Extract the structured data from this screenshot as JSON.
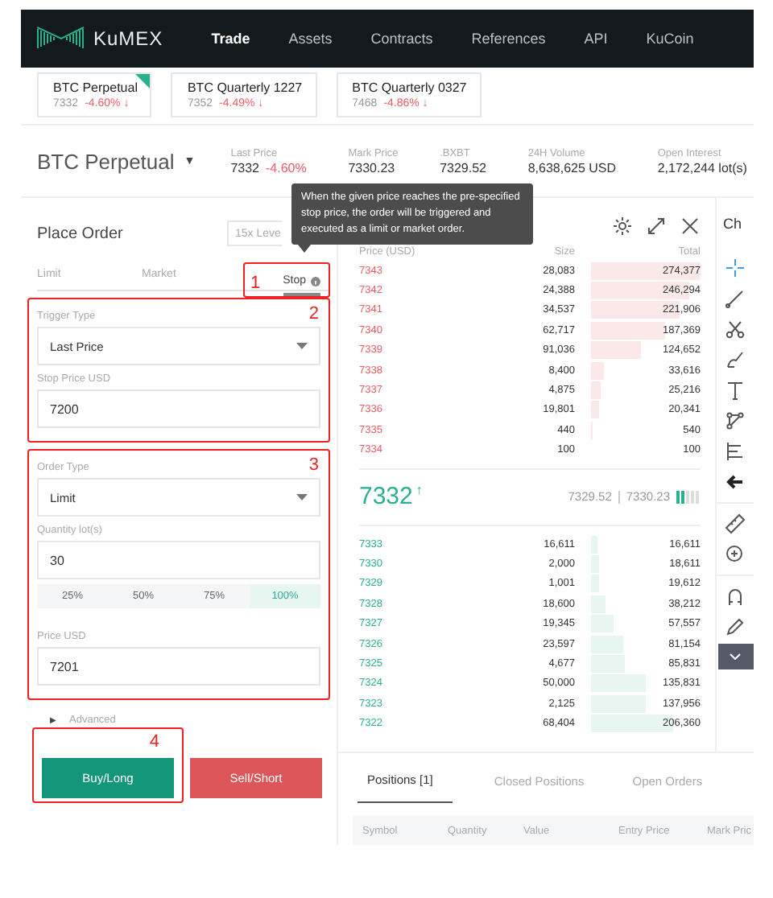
{
  "nav": {
    "logo": "KuMEX",
    "items": [
      {
        "label": "Trade",
        "selected": true
      },
      {
        "label": "Assets",
        "selected": false
      },
      {
        "label": "Contracts",
        "selected": false
      },
      {
        "label": "References",
        "selected": false
      },
      {
        "label": "API",
        "selected": false
      },
      {
        "label": "KuCoin",
        "selected": false
      }
    ]
  },
  "tickers": [
    {
      "name": "BTC Perpetual",
      "price": "7332",
      "change": "-4.60% ↓",
      "selected": true
    },
    {
      "name": "BTC Quarterly 1227",
      "price": "7352",
      "change": "-4.49% ↓",
      "selected": false
    },
    {
      "name": "BTC Quarterly 0327",
      "price": "7468",
      "change": "-4.86% ↓",
      "selected": false
    }
  ],
  "contract": {
    "name": "BTC Perpetual",
    "caret": "▼",
    "stats": [
      {
        "label": "Last Price",
        "value": "7332",
        "change": "-4.60%"
      },
      {
        "label": "Mark Price",
        "value": "7330.23"
      },
      {
        "label": ".BXBT",
        "value": "7329.52"
      },
      {
        "label": "24H Volume",
        "value": "8,638,625 USD"
      },
      {
        "label": "Open Interest",
        "value": "2,172,244 lot(s)"
      }
    ]
  },
  "tooltip": "When the given price reaches the pre-specified stop price, the order will be triggered and executed as a limit or market order.",
  "order_form": {
    "title": "Place Order",
    "leverage": "15x Leve",
    "tabs": [
      {
        "label": "Limit",
        "selected": false
      },
      {
        "label": "Market",
        "selected": false
      },
      {
        "label": "Stop",
        "selected": true,
        "marker": "1"
      }
    ],
    "trigger": {
      "marker": "2",
      "fields": [
        {
          "kind": "select",
          "label": "Trigger Type",
          "value": "Last Price"
        },
        {
          "kind": "input",
          "label": "Stop Price USD",
          "value": "7200"
        }
      ]
    },
    "order": {
      "marker": "3",
      "fields": [
        {
          "kind": "select",
          "label": "Order Type",
          "value": "Limit"
        },
        {
          "kind": "input",
          "label": "Quantity lot(s)",
          "value": "30",
          "presets": [
            {
              "label": "25%",
              "selected": false
            },
            {
              "label": "50%",
              "selected": false
            },
            {
              "label": "75%",
              "selected": false
            },
            {
              "label": "100%",
              "selected": true
            }
          ]
        },
        {
          "kind": "input",
          "label": "Price USD",
          "value": "7201"
        }
      ]
    },
    "advanced": {
      "caret": "▶",
      "label": "Advanced"
    },
    "buttons": [
      {
        "kind": "buy",
        "label": "Buy/Long",
        "marker": "4"
      },
      {
        "kind": "sell",
        "label": "Sell/Short"
      }
    ]
  },
  "order_book": {
    "columns": [
      "Price (USD)",
      "Size",
      "Total"
    ],
    "asks": [
      {
        "price": "7343",
        "size": "28,083",
        "total": "274,377"
      },
      {
        "price": "7342",
        "size": "24,388",
        "total": "246,294"
      },
      {
        "price": "7341",
        "size": "34,537",
        "total": "221,906"
      },
      {
        "price": "7340",
        "size": "62,717",
        "total": "187,369"
      },
      {
        "price": "7339",
        "size": "91,036",
        "total": "124,652"
      },
      {
        "price": "7338",
        "size": "8,400",
        "total": "33,616"
      },
      {
        "price": "7337",
        "size": "4,875",
        "total": "25,216"
      },
      {
        "price": "7336",
        "size": "19,801",
        "total": "20,341"
      },
      {
        "price": "7335",
        "size": "440",
        "total": "540"
      },
      {
        "price": "7334",
        "size": "100",
        "total": "100"
      }
    ],
    "last_price": {
      "value": "7332",
      "arrow": "↑",
      "prices": [
        "7329.52",
        "7330.23"
      ]
    },
    "bids": [
      {
        "price": "7333",
        "size": "16,611",
        "total": "16,611"
      },
      {
        "price": "7330",
        "size": "2,000",
        "total": "18,611"
      },
      {
        "price": "7329",
        "size": "1,001",
        "total": "19,612"
      },
      {
        "price": "7328",
        "size": "18,600",
        "total": "38,212"
      },
      {
        "price": "7327",
        "size": "19,345",
        "total": "57,557"
      },
      {
        "price": "7326",
        "size": "23,597",
        "total": "81,154"
      },
      {
        "price": "7325",
        "size": "4,677",
        "total": "85,831"
      },
      {
        "price": "7324",
        "size": "50,000",
        "total": "135,831"
      },
      {
        "price": "7323",
        "size": "2,125",
        "total": "137,956"
      },
      {
        "price": "7322",
        "size": "68,404",
        "total": "206,360"
      }
    ]
  },
  "chart_panel": {
    "title": "Ch"
  },
  "positions": {
    "tabs": [
      {
        "label": "Positions [1]",
        "selected": true
      },
      {
        "label": "Closed Positions",
        "selected": false
      },
      {
        "label": "Open Orders",
        "selected": false
      }
    ],
    "columns": [
      "Symbol",
      "Quantity",
      "Value",
      "Entry Price",
      "Mark Pric"
    ]
  }
}
